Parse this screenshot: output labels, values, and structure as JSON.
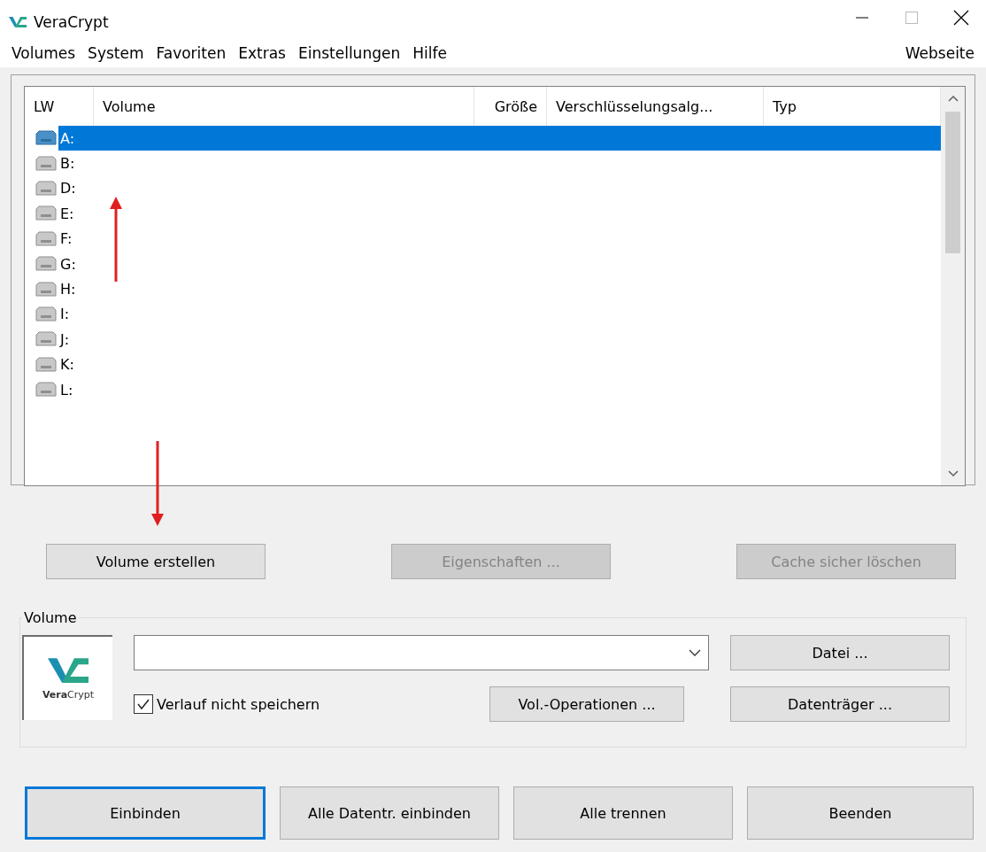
{
  "window": {
    "title": "VeraCrypt"
  },
  "menu": [
    "Volumes",
    "System",
    "Favoriten",
    "Extras",
    "Einstellungen",
    "Hilfe"
  ],
  "menu_right": "Webseite",
  "table": {
    "columns": [
      "LW",
      "Volume",
      "Größe",
      "Verschlüsselungsalg...",
      "Typ"
    ],
    "rows": [
      {
        "drive": "A:",
        "selected": true
      },
      {
        "drive": "B:",
        "selected": false
      },
      {
        "drive": "D:",
        "selected": false
      },
      {
        "drive": "E:",
        "selected": false
      },
      {
        "drive": "F:",
        "selected": false
      },
      {
        "drive": "G:",
        "selected": false
      },
      {
        "drive": "H:",
        "selected": false
      },
      {
        "drive": "I:",
        "selected": false
      },
      {
        "drive": "J:",
        "selected": false
      },
      {
        "drive": "K:",
        "selected": false
      },
      {
        "drive": "L:",
        "selected": false
      }
    ]
  },
  "top_buttons": [
    {
      "label": "Volume erstellen",
      "disabled": false
    },
    {
      "label": "Eigenschaften ...",
      "disabled": true
    },
    {
      "label": "Cache sicher löschen",
      "disabled": true
    }
  ],
  "volume_group": {
    "title": "Volume",
    "logo_text": "**Vera**Crypt",
    "history": {
      "label": "Verlauf nicht speichern",
      "checked": true
    },
    "buttons": [
      "Datei ...",
      "Vol.-Operationen ...",
      "Datenträger ..."
    ]
  },
  "bottom_buttons": [
    {
      "label": "Einbinden",
      "default": true
    },
    {
      "label": "Alle Datentr. einbinden",
      "default": false
    },
    {
      "label": "Alle trennen",
      "default": false
    },
    {
      "label": "Beenden",
      "default": false
    }
  ],
  "annotations": [
    {
      "kind": "arrow-up"
    },
    {
      "kind": "arrow-down"
    }
  ]
}
